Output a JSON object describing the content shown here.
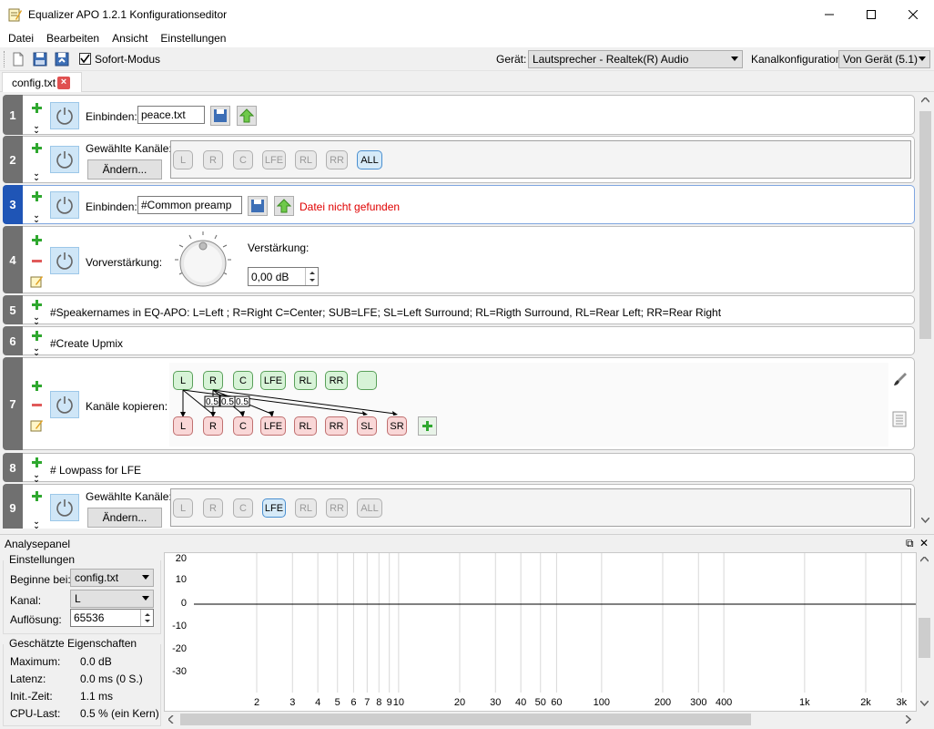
{
  "window": {
    "title": "Equalizer APO 1.2.1 Konfigurationseditor"
  },
  "menu": [
    "Datei",
    "Bearbeiten",
    "Ansicht",
    "Einstellungen"
  ],
  "toolbar": {
    "instant_mode_label": "Sofort-Modus",
    "instant_mode_checked": true,
    "device_label": "Gerät:",
    "device_value": "Lautsprecher - Realtek(R) Audio",
    "channel_config_label": "Kanalkonfiguration:",
    "channel_config_value": "Von Gerät (5.1)"
  },
  "tab": {
    "label": "config.txt"
  },
  "filters": [
    {
      "num": "1",
      "label": "Einbinden:",
      "value": "peace.txt"
    },
    {
      "num": "2",
      "label": "Gewählte Kanäle:",
      "button": "Ändern...",
      "channels": [
        "L",
        "R",
        "C",
        "LFE",
        "RL",
        "RR",
        "ALL"
      ],
      "selected": "ALL"
    },
    {
      "num": "3",
      "label": "Einbinden:",
      "value": "#Common preamp",
      "error": "Datei nicht gefunden"
    },
    {
      "num": "4",
      "label": "Vorverstärkung:",
      "gain_label": "Verstärkung:",
      "gain_value": "0,00 dB"
    },
    {
      "num": "5",
      "comment": "#Speakernames in EQ-APO: L=Left ; R=Right C=Center; SUB=LFE; SL=Left Surround; RL=Rigth Surround, RL=Rear Left; RR=Rear Right"
    },
    {
      "num": "6",
      "comment": "#Create Upmix"
    },
    {
      "num": "7",
      "label": "Kanäle kopieren:",
      "sources": [
        "L",
        "R",
        "C",
        "LFE",
        "RL",
        "RR",
        ""
      ],
      "targets": [
        "L",
        "R",
        "C",
        "LFE",
        "RL",
        "RR",
        "SL",
        "SR"
      ],
      "gains": [
        "0.5",
        "0.5",
        "0.5"
      ]
    },
    {
      "num": "8",
      "comment": "# Lowpass for LFE"
    },
    {
      "num": "9",
      "label": "Gewählte Kanäle:",
      "button": "Ändern...",
      "channels": [
        "L",
        "R",
        "C",
        "LFE",
        "RL",
        "RR",
        "ALL"
      ],
      "selected": "LFE"
    }
  ],
  "analysis": {
    "title": "Analysepanel",
    "settings_title": "Einstellungen",
    "start_label": "Beginne bei:",
    "start_value": "config.txt",
    "channel_label": "Kanal:",
    "channel_value": "L",
    "resolution_label": "Auflösung:",
    "resolution_value": "65536",
    "props_title": "Geschätzte Eigenschaften",
    "props": [
      {
        "label": "Maximum:",
        "value": "0.0 dB"
      },
      {
        "label": "Latenz:",
        "value": "0.0 ms (0 S.)"
      },
      {
        "label": "Init.-Zeit:",
        "value": "1.1 ms"
      },
      {
        "label": "CPU-Last:",
        "value": "0.5 % (ein Kern)"
      }
    ],
    "y_ticks": [
      "20",
      "10",
      "0",
      "-10",
      "-20",
      "-30"
    ],
    "x_ticks": [
      "2",
      "3",
      "4",
      "5",
      "6",
      "7",
      "8",
      "9",
      "10",
      "20",
      "30",
      "40",
      "50",
      "60",
      "100",
      "200",
      "300",
      "400",
      "1k",
      "2k",
      "3k"
    ]
  }
}
